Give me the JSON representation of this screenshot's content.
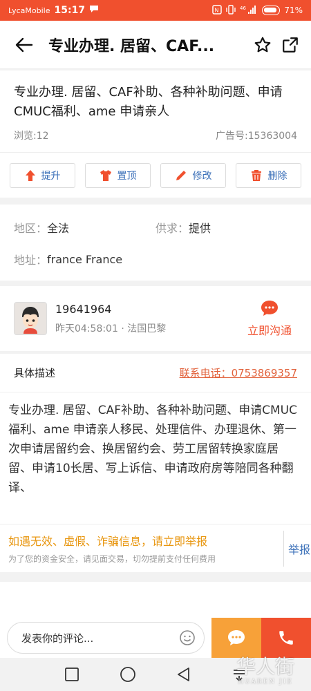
{
  "status_bar": {
    "carrier": "LycaMobile",
    "time": "15:17",
    "signal": "46",
    "battery": "71%"
  },
  "header": {
    "title": "专业办理. 居留、CAF..."
  },
  "post": {
    "title": "专业办理. 居留、CAF补助、各种补助问题、申请 CMUC福利、ame 申请亲人",
    "views": "浏览:12",
    "ad_no": "广告号:15363004"
  },
  "actions": [
    {
      "label": "提升",
      "icon": "arrow-up-icon"
    },
    {
      "label": "置顶",
      "icon": "shirt-icon"
    },
    {
      "label": "修改",
      "icon": "pencil-icon"
    },
    {
      "label": "删除",
      "icon": "trash-icon"
    }
  ],
  "info": {
    "region_label": "地区：",
    "region_value": "全法",
    "supply_label": "供求：",
    "supply_value": "提供",
    "address_label": "地址：",
    "address_value": "france France"
  },
  "user": {
    "name": "19641964",
    "sub": "昨天04:58:01 · 法国巴黎",
    "contact_label": "立即沟通"
  },
  "description": {
    "label": "具体描述",
    "phone": "联系电话：0753869357",
    "body": "专业办理. 居留、CAF补助、各种补助问题、申请CMUC福利、ame 申请亲人移民、处理信件、办理退休、第一次申请居留约会、换居留约会、劳工居留转换家庭居留、申请10长居、写上诉信、申请政府房等陪同各种翻译、"
  },
  "report": {
    "warning": "如遇无效、虚假、诈骗信息，请立即举报",
    "tip": "为了您的资金安全，请见面交易，切勿提前支付任何费用",
    "button": "举报"
  },
  "bottom": {
    "comment_placeholder": "发表你的评论..."
  },
  "watermark": {
    "text": "华人街",
    "sub": "HUAREN JIE"
  },
  "colors": {
    "brand": "#f0502e",
    "link": "#3a6fb8",
    "warn": "#e8960f",
    "chat": "#f7a139"
  }
}
